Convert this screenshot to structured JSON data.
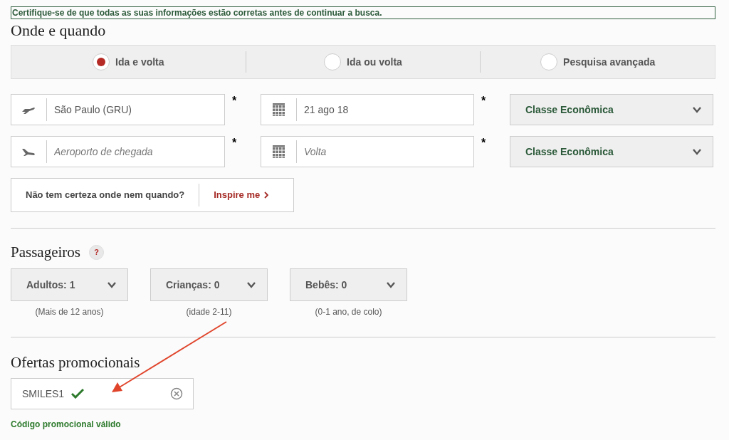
{
  "notice": "Certifique-se de que todas as suas informações estão corretas antes de continuar a busca.",
  "where_when": {
    "title": "Onde e quando",
    "trip_types": [
      {
        "label": "Ida e volta",
        "selected": true
      },
      {
        "label": "Ida ou volta",
        "selected": false
      },
      {
        "label": "Pesquisa avançada",
        "selected": false
      }
    ],
    "legs": [
      {
        "kind": "departure",
        "airport": {
          "value": "São Paulo (GRU)"
        },
        "required_mark": "*",
        "date": {
          "value": "21 ago 18"
        },
        "date_required_mark": "*",
        "cabin": "Classe Econômica"
      },
      {
        "kind": "arrival",
        "airport": {
          "placeholder": "Aeroporto de chegada"
        },
        "required_mark": "*",
        "date": {
          "placeholder": "Volta"
        },
        "date_required_mark": "*",
        "cabin": "Classe Econômica"
      }
    ],
    "inspire": {
      "question": "Não tem certeza onde nem quando?",
      "link": "Inspire me"
    }
  },
  "passengers": {
    "title": "Passageiros",
    "help": "?",
    "groups": [
      {
        "label": "Adultos: 1",
        "note": "(Mais de 12 anos)"
      },
      {
        "label": "Crianças: 0",
        "note": "(idade 2-11)"
      },
      {
        "label": "Bebês: 0",
        "note": "(0-1 ano, de colo)"
      }
    ]
  },
  "promo": {
    "title": "Ofertas promocionais",
    "code": "SMILES1",
    "valid": true,
    "message": "Código promocional válido"
  }
}
